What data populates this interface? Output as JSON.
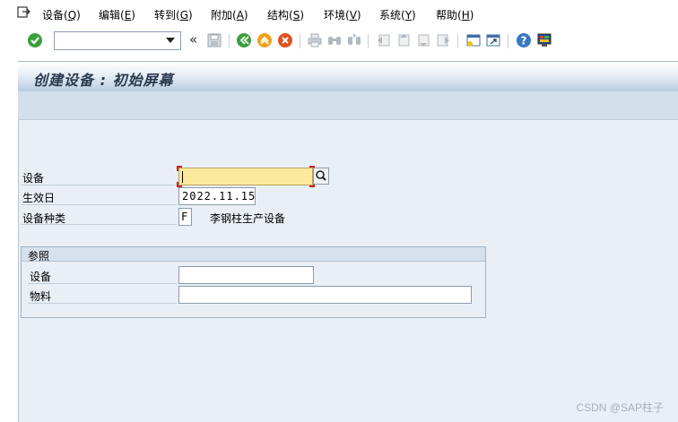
{
  "menu": {
    "items": [
      {
        "label": "设备(",
        "key": "Q",
        "close": ")"
      },
      {
        "label": "编辑(",
        "key": "E",
        "close": ")"
      },
      {
        "label": "转到(",
        "key": "G",
        "close": ")"
      },
      {
        "label": "附加(",
        "key": "A",
        "close": ")"
      },
      {
        "label": "结构(",
        "key": "S",
        "close": ")"
      },
      {
        "label": "环境(",
        "key": "V",
        "close": ")"
      },
      {
        "label": "系统(",
        "key": "Y",
        "close": ")"
      },
      {
        "label": "帮助(",
        "key": "H",
        "close": ")"
      }
    ]
  },
  "toolbar": {
    "command_value": "",
    "collapse_glyph": "«",
    "icons": [
      "enter-icon",
      "save-icon",
      "back-icon",
      "exit-icon",
      "cancel-icon",
      "print-icon",
      "find-icon",
      "find-next-icon",
      "first-page-icon",
      "previous-page-icon",
      "next-page-icon",
      "last-page-icon",
      "new-session-icon",
      "shortcut-icon",
      "help-icon",
      "customize-layout-icon"
    ]
  },
  "screen": {
    "title": "创建设备 : 初始屏幕"
  },
  "form": {
    "equipment_label": "设备",
    "equipment_value": "",
    "valid_from_label": "生效日",
    "valid_from_value": "2022.11.15",
    "category_label": "设备种类",
    "category_value": "F",
    "category_desc": "李钢柱生产设备"
  },
  "reference": {
    "title": "参照",
    "equipment_label": "设备",
    "equipment_value": "",
    "material_label": "物料",
    "material_value": ""
  },
  "watermark": "CSDN @SAP柱子",
  "colors": {
    "accent_green": "#3aa03a",
    "accent_orange": "#f0a020",
    "accent_red": "#e05020",
    "required_yellow": "#fde99c",
    "work_bg": "#e9eff5"
  }
}
